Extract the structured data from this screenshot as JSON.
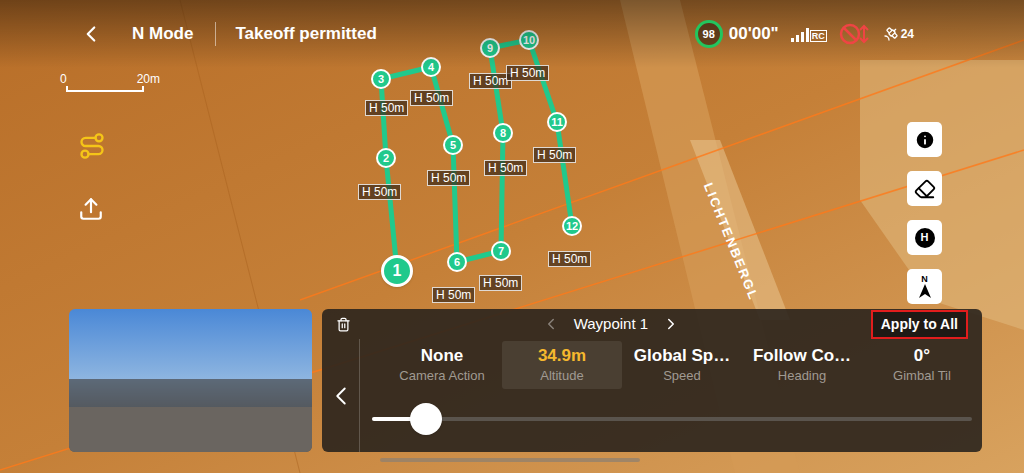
{
  "top_bar": {
    "mode": "N Mode",
    "status": "Takeoff permitted",
    "battery": "98",
    "timer": "00'00\"",
    "signal": "RC",
    "satellites": "24"
  },
  "scale": {
    "zero": "0",
    "distance": "20m"
  },
  "map": {
    "road_label": "LICHTENBERGL"
  },
  "tools": {
    "home_marker": "H",
    "north_marker": "N"
  },
  "waypoints": [
    {
      "number": "1",
      "altitude": "",
      "selected": true
    },
    {
      "number": "2",
      "altitude": "H 50m",
      "selected": false
    },
    {
      "number": "3",
      "altitude": "H 50m",
      "selected": false
    },
    {
      "number": "4",
      "altitude": "H 50m",
      "selected": false
    },
    {
      "number": "5",
      "altitude": "H 50m",
      "selected": false
    },
    {
      "number": "6",
      "altitude": "H 50m",
      "selected": false
    },
    {
      "number": "7",
      "altitude": "H 50m",
      "selected": false
    },
    {
      "number": "8",
      "altitude": "H 50m",
      "selected": false
    },
    {
      "number": "9",
      "altitude": "H 50m",
      "selected": false
    },
    {
      "number": "10",
      "altitude": "H 50m",
      "selected": false
    },
    {
      "number": "11",
      "altitude": "H 50m",
      "selected": false
    },
    {
      "number": "12",
      "altitude": "H 50m",
      "selected": false
    }
  ],
  "panel": {
    "title": "Waypoint 1",
    "apply": "Apply to All",
    "settings": [
      {
        "value": "None",
        "label": "Camera Action",
        "selected": false
      },
      {
        "value": "34.9m",
        "label": "Altitude",
        "selected": true
      },
      {
        "value": "Global Sp…",
        "label": "Speed",
        "selected": false
      },
      {
        "value": "Follow Co…",
        "label": "Heading",
        "selected": false
      },
      {
        "value": "0°",
        "label": "Gimbal Til",
        "selected": false
      }
    ],
    "slider": {
      "level": 0.09
    }
  }
}
